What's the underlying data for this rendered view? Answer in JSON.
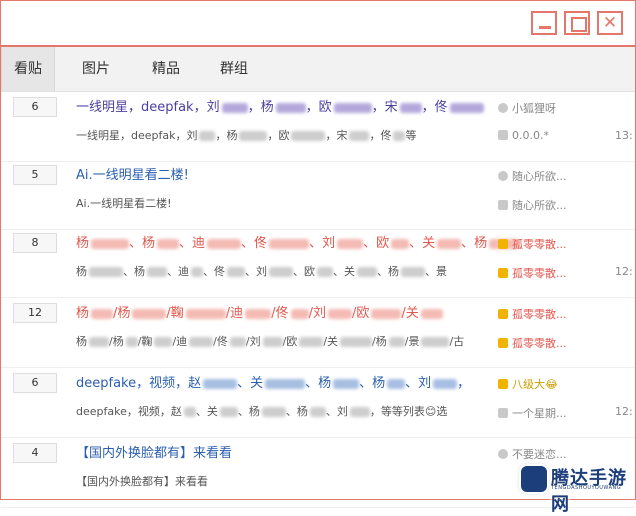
{
  "window": {
    "min_icon": "minimize-icon",
    "max_icon": "maximize-icon",
    "close_icon": "close-icon",
    "close_glyph": "✕"
  },
  "tabs": [
    {
      "label": "看贴",
      "active": true
    },
    {
      "label": "图片",
      "active": false
    },
    {
      "label": "精品",
      "active": false
    },
    {
      "label": "群组",
      "active": false
    }
  ],
  "threads": [
    {
      "count": "6",
      "title_parts": [
        "一线明星，deepfak，刘",
        "，杨",
        "，欧",
        "，宋",
        "，佟"
      ],
      "title_color": "purple",
      "preview_parts": [
        "一线明星，deepfak，刘",
        "，杨",
        "，欧",
        "，宋",
        "，佟",
        "等"
      ],
      "author": "小狐狸呀",
      "author_style": "normal",
      "reply": "0.0.0.*",
      "time": "13:"
    },
    {
      "count": "5",
      "title_parts": [
        "Ai.一线明星看二楼!"
      ],
      "title_color": "blue",
      "preview_parts": [
        "Ai.一线明星看二楼!"
      ],
      "author": "随心所欲...",
      "author_style": "normal",
      "reply": "随心所欲...",
      "time": ""
    },
    {
      "count": "8",
      "title_parts": [
        "杨",
        "、杨",
        "、迪",
        "、佟",
        "、刘",
        "、欧",
        "、关",
        "、杨"
      ],
      "title_color": "red",
      "preview_parts": [
        "杨",
        "、杨",
        "、迪",
        "、佟",
        "、刘",
        "、欧",
        "、关",
        "、杨",
        "、景"
      ],
      "author": "孤零零散...",
      "author_style": "orange",
      "reply": "孤零零散...",
      "time": "12:"
    },
    {
      "count": "12",
      "title_parts": [
        "杨",
        "/杨",
        "/鞠",
        "/迪",
        "/佟",
        "/刘",
        "/欧",
        "/关"
      ],
      "title_color": "red",
      "preview_parts": [
        "杨",
        "/杨",
        "/鞠",
        "/迪",
        "/佟",
        "/刘",
        "/欧",
        "/关",
        "/杨",
        "/景",
        "/古"
      ],
      "author": "孤零零散...",
      "author_style": "orange",
      "reply": "孤零零散...",
      "time": ""
    },
    {
      "count": "6",
      "title_parts": [
        "deepfake，视频，赵",
        "、关",
        "、杨",
        "、杨",
        "、刘",
        "，"
      ],
      "title_color": "blue",
      "preview_parts": [
        "deepfake，视频，赵",
        "、关",
        "、杨",
        "、杨",
        "、刘",
        "，等等列表😊选"
      ],
      "author": "八级大😂",
      "author_style": "gold",
      "reply": "一个星期...",
      "time": "12:"
    },
    {
      "count": "4",
      "title_parts": [
        "【国内外换脸都有】来看看"
      ],
      "title_color": "blue",
      "preview_parts": [
        "【国内外换脸都有】来看看"
      ],
      "author": "不要迷恋...",
      "author_style": "normal",
      "reply": "",
      "time": ""
    }
  ],
  "watermark": {
    "title": "腾达手游网",
    "subtitle": "TENGDASHOUYOUWANG"
  }
}
